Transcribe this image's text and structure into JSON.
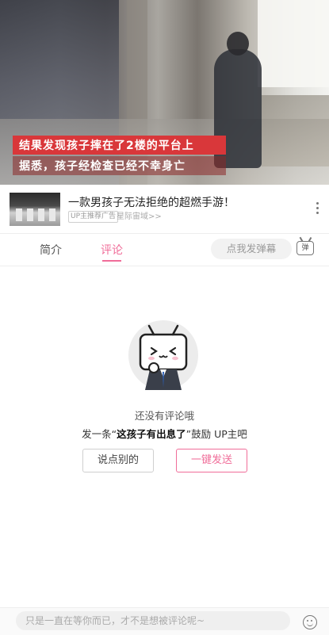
{
  "video": {
    "caption_line1": "结果发现孩子摔在了2楼的平台上",
    "caption_line2": "据悉，孩子经检查已经不幸身亡"
  },
  "ad": {
    "title": "一款男孩子无法拒绝的超燃手游！",
    "badge": "UP主推荐广告",
    "source": "星际宙域>>",
    "more_icon": "more-vertical-icon"
  },
  "tabs": {
    "intro": "简介",
    "comment": "评论",
    "active": "评论",
    "danmaku_placeholder": "点我发弹幕",
    "danmaku_icon_label": "弹"
  },
  "empty_state": {
    "line1": "还没有评论哦",
    "line2_prefix": "发一条“",
    "line2_highlight": "这孩子有出息了",
    "line2_suffix": "”鼓励 UP主吧",
    "say_button": "说点别的",
    "send_button": "一键发送"
  },
  "bottom": {
    "comment_placeholder": "只是一直在等你而已，才不是想被评论呢~",
    "emoji_icon": "emoji-icon"
  },
  "colors": {
    "accent": "#f06d99",
    "caption_red": "#d9373a"
  }
}
